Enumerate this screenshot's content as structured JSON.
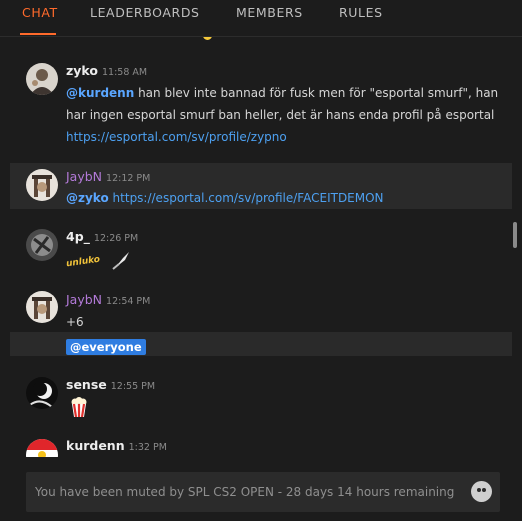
{
  "tabs": [
    {
      "label": "CHAT",
      "active": true
    },
    {
      "label": "LEADERBOARDS",
      "active": false
    },
    {
      "label": "MEMBERS",
      "active": false
    },
    {
      "label": "RULES",
      "active": false
    }
  ],
  "colors": {
    "accent": "#ff6a2b",
    "mention": "#5aa6ff",
    "link": "#4da0f0",
    "everyone_badge": "#2f7de1",
    "purple_user": "#b37ad8"
  },
  "messages": [
    {
      "user": "zyko",
      "time": "11:58 AM",
      "mention": "@kurdenn",
      "text_line1": " han blev inte bannad för fusk men för \"esportal smurf\", han",
      "text_line2": "har ingen esportal smurf ban heller, det är hans enda profil på esportal",
      "link": "https://esportal.com/sv/profile/zypno"
    },
    {
      "user": "JaybN",
      "time": "12:12 PM",
      "mention": "@zyko",
      "link": "https://esportal.com/sv/profile/FACEITDEMON"
    },
    {
      "user": "4p_",
      "time": "12:26 PM",
      "sticker": "unluko"
    },
    {
      "user": "JaybN",
      "time": "12:54 PM",
      "text": "+6",
      "everyone": "@everyone"
    },
    {
      "user": "sense",
      "time": "12:55 PM",
      "emoji": "popcorn-icon"
    },
    {
      "user": "kurdenn",
      "time": "1:32 PM"
    }
  ],
  "composer": {
    "muted_text": "You have been muted by SPL CS2 OPEN - 28 days 14 hours remaining",
    "emoji_icon": "smiley-icon"
  }
}
